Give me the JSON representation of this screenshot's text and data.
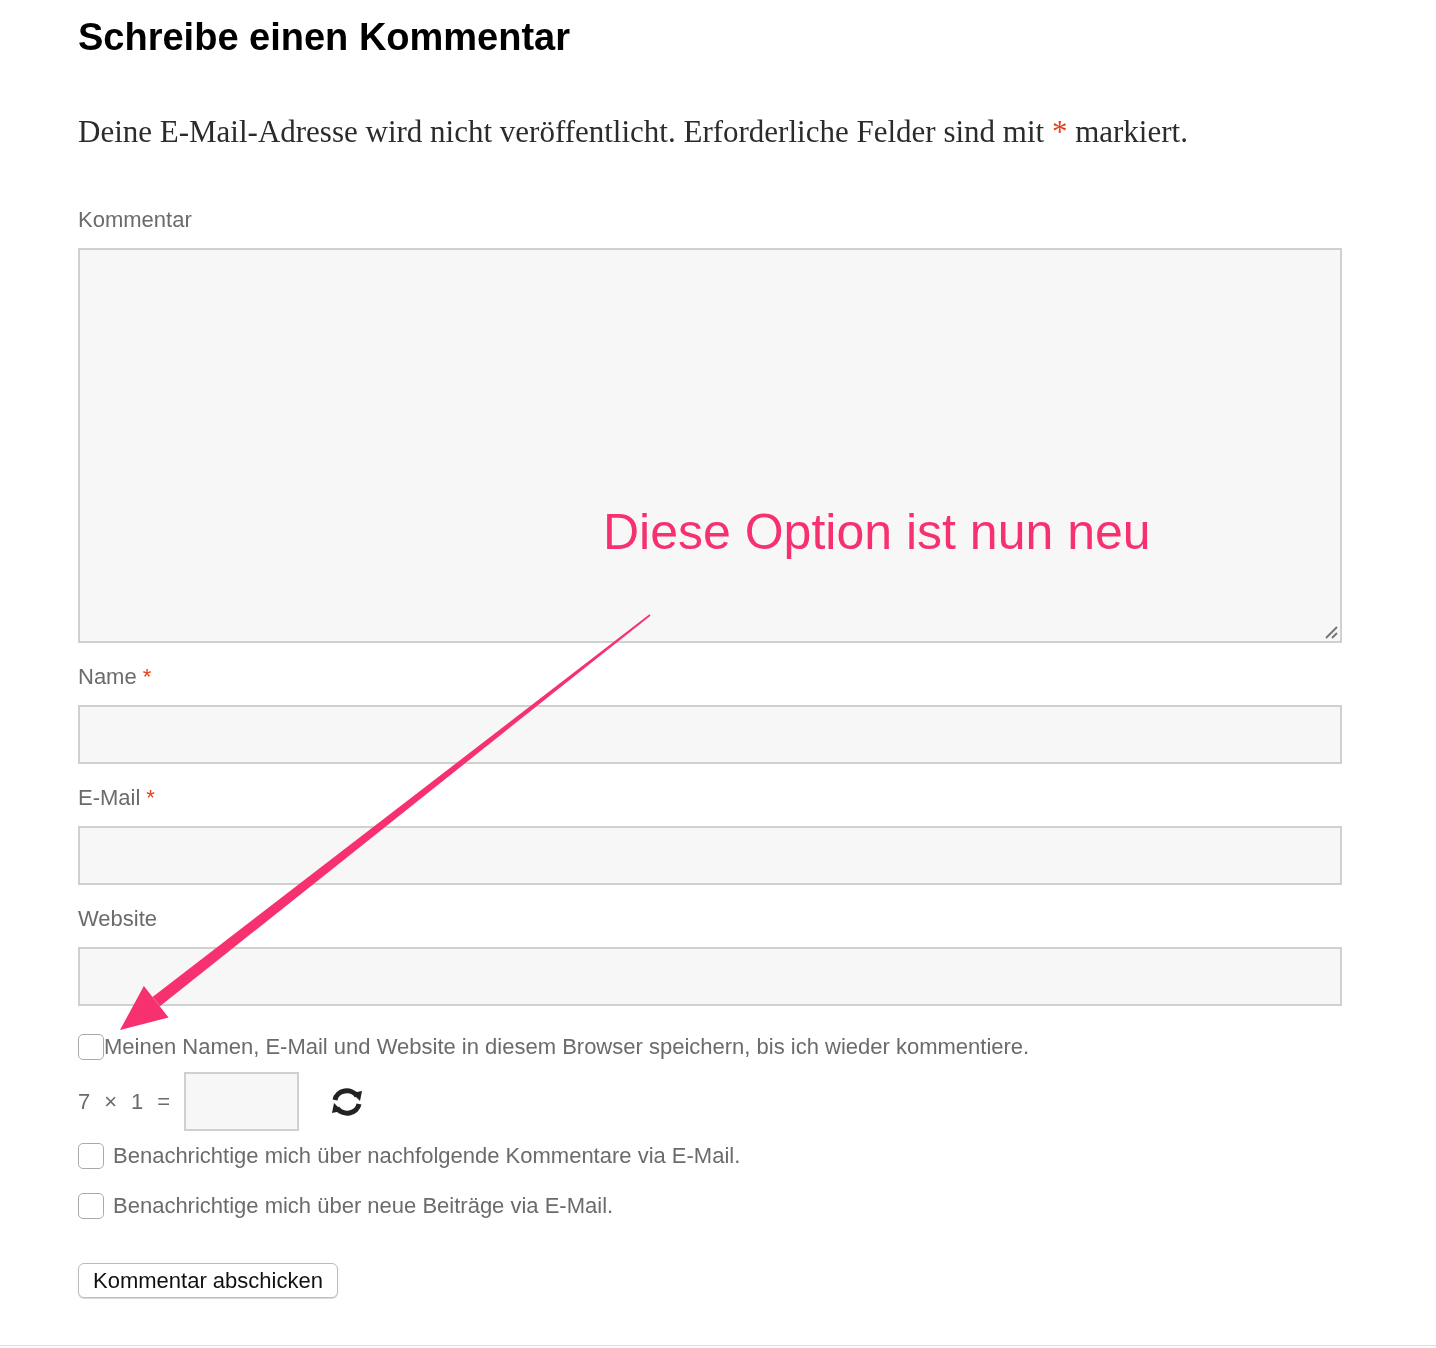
{
  "title": "Schreibe einen Kommentar",
  "intro": {
    "before": "Deine E-Mail-Adresse wird nicht veröffentlicht. Erforderliche Felder sind mit",
    "marker": "*",
    "after": "markiert."
  },
  "fields": [
    {
      "label": "Kommentar",
      "required": false,
      "kind": "textarea"
    },
    {
      "label": "Name",
      "required": true,
      "kind": "text"
    },
    {
      "label": "E-Mail",
      "required": true,
      "kind": "text"
    },
    {
      "label": "Website",
      "required": false,
      "kind": "text"
    }
  ],
  "required_marker": "*",
  "save_option": {
    "label": "Meinen Namen, E-Mail und Website in diesem Browser speichern, bis ich wieder kommentiere.",
    "checked": false
  },
  "captcha": {
    "parts": [
      "7",
      "×",
      "1",
      "="
    ]
  },
  "notify_options": [
    {
      "label": "Benachrichtige mich über nachfolgende Kommentare via E-Mail.",
      "checked": false
    },
    {
      "label": "Benachrichtige mich über neue Beiträge via E-Mail.",
      "checked": false
    }
  ],
  "submit_button": "Kommentar abschicken",
  "annotation": {
    "text": "Diese Option ist nun neu"
  }
}
